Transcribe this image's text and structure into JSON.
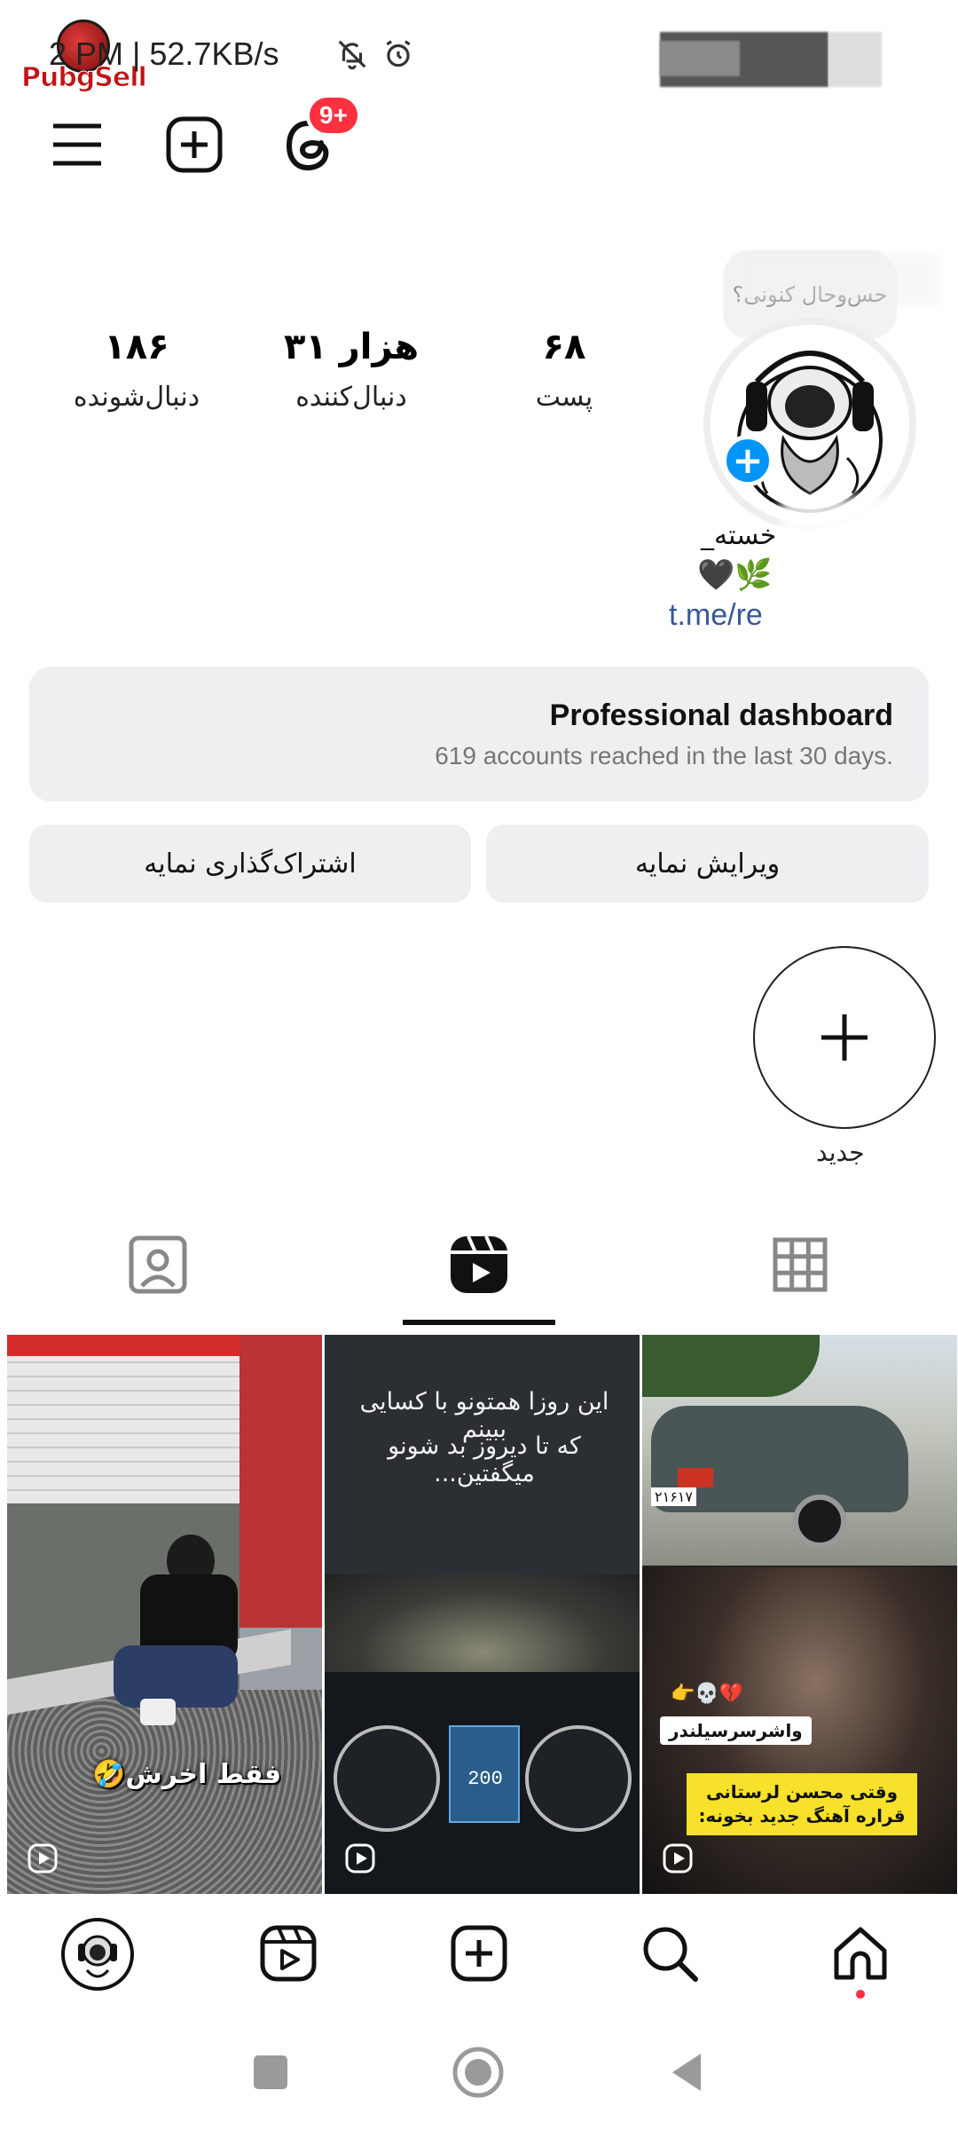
{
  "status_bar": {
    "time_and_speed": "2 PM | 52.7KB/s",
    "watermark_text": "PubgSell"
  },
  "header": {
    "notification_badge": "9+"
  },
  "profile": {
    "note_text": "حس‌وحال کنونی؟",
    "name_fragment": "خسته_",
    "bio_emoji": "🖤🌿",
    "link_fragment": "t.me/re"
  },
  "stats": [
    {
      "value": "۱۸۶",
      "label": "دنبال‌شونده"
    },
    {
      "value": "۳۱ هزار",
      "label": "دنبال‌کننده"
    },
    {
      "value": "۶۸",
      "label": "پست"
    }
  ],
  "dashboard": {
    "title": "Professional dashboard",
    "subtitle": "619 accounts reached in the last 30 days."
  },
  "buttons": {
    "share_profile": "اشتراک‌گذاری نمایه",
    "edit_profile": "ویرایش نمایه"
  },
  "highlights": {
    "new_label": "جدید"
  },
  "tabs": {
    "active": "reels",
    "items": [
      "tagged",
      "reels",
      "grid"
    ]
  },
  "reels": [
    {
      "overlay": "فقط اخرش🤣"
    },
    {
      "overlay_line1": "این روزا همتونو با کسایی ببینم",
      "overlay_line2": "که تا دیروز بد شونو میگفتین...",
      "speed_readout": "200"
    },
    {
      "plate": "۲۱۶۱۷",
      "tag1": "💔💀👉",
      "tag2": "واشرسرسیلندر",
      "caption": "وقتی محسن لرستانی قراره آهنگ جدید بخونه:"
    }
  ],
  "bottom_nav": [
    "profile",
    "reels",
    "create",
    "search",
    "home"
  ],
  "colors": {
    "accent_blue": "#0095f6",
    "badge_red": "#ff3040",
    "caption_yellow": "#f7e12a"
  }
}
